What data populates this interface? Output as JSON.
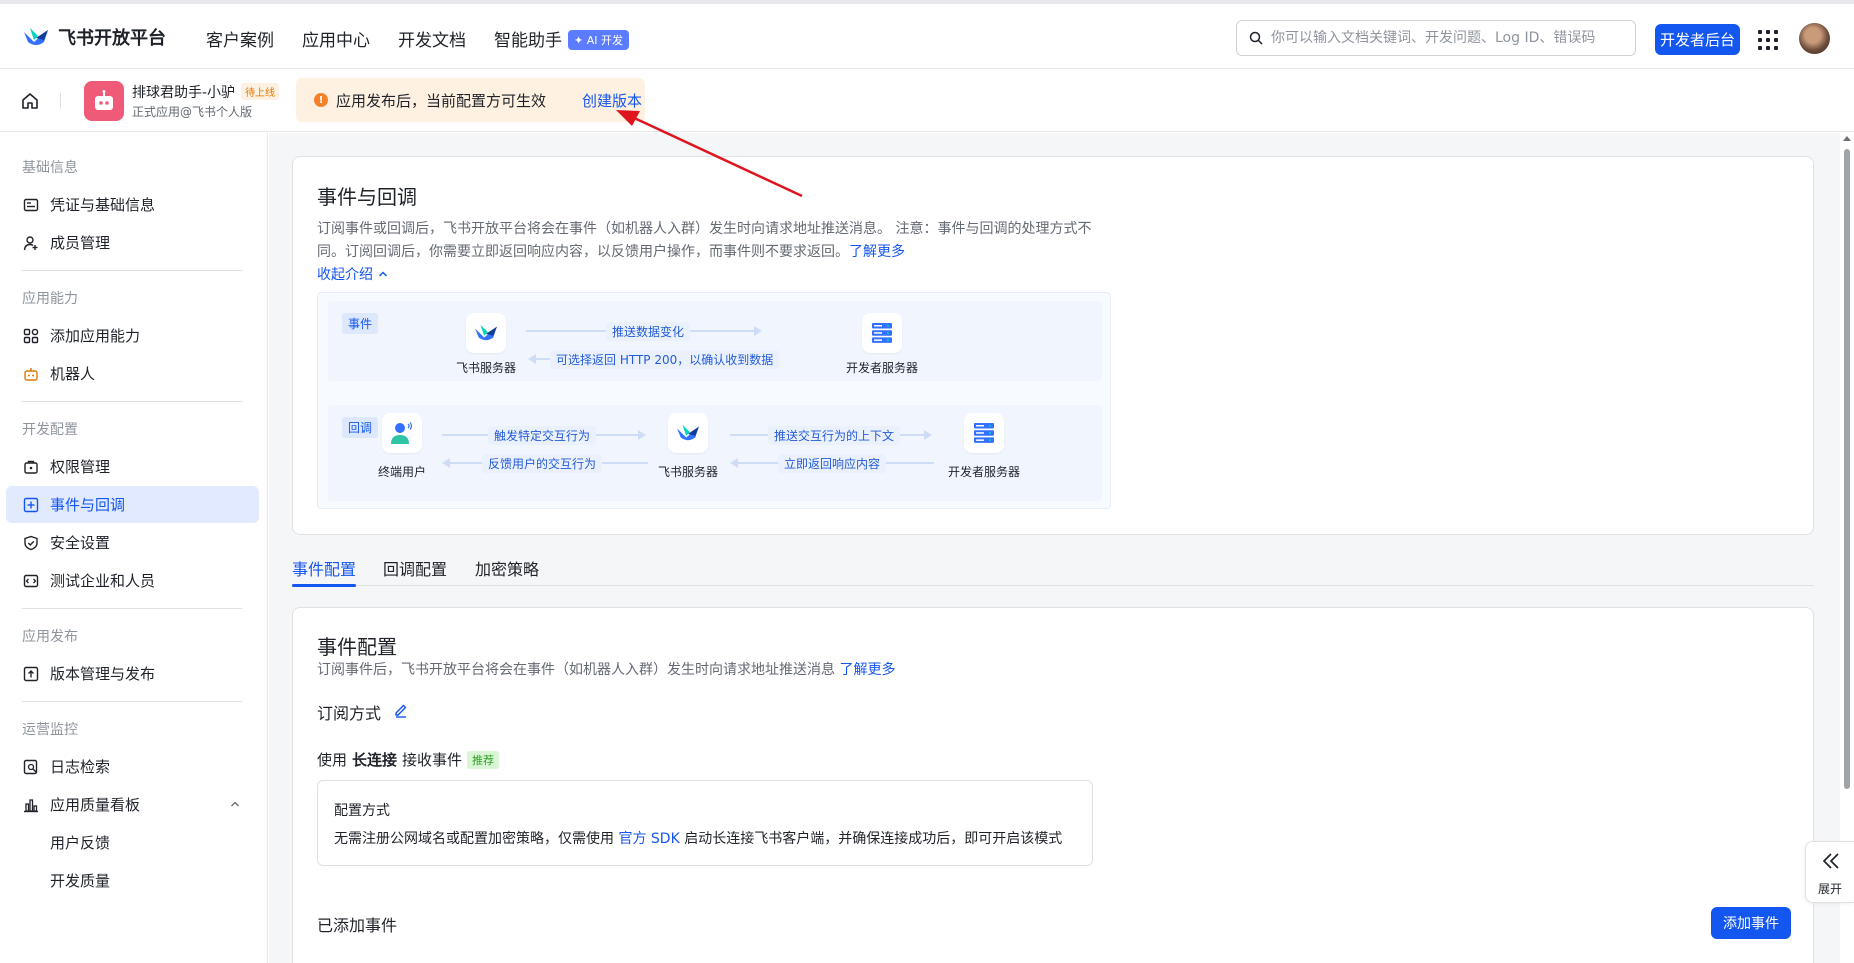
{
  "topbar": {
    "logo_text": "飞书开放平台",
    "nav": [
      "客户案例",
      "应用中心",
      "开发文档",
      "智能助手"
    ],
    "ai_badge": "✦ AI 开发",
    "search_placeholder": "你可以输入文档关键词、开发问题、Log ID、错误码",
    "dev_console": "开发者后台"
  },
  "appbar": {
    "app_name": "排球君助手-小驴",
    "app_status": "待上线",
    "app_sub": "正式应用@飞书个人版",
    "notice_text": "应用发布后，当前配置方可生效",
    "notice_link": "创建版本"
  },
  "sidebar": {
    "groups": [
      "基础信息",
      "应用能力",
      "开发配置",
      "应用发布",
      "运营监控"
    ],
    "items": [
      {
        "label": "凭证与基础信息",
        "icon": "credential-icon"
      },
      {
        "label": "成员管理",
        "icon": "member-add-icon"
      },
      {
        "label": "添加应用能力",
        "icon": "app-grid-icon"
      },
      {
        "label": "机器人",
        "icon": "robot-icon"
      },
      {
        "label": "权限管理",
        "icon": "permission-icon"
      },
      {
        "label": "事件与回调",
        "icon": "event-icon"
      },
      {
        "label": "安全设置",
        "icon": "shield-icon"
      },
      {
        "label": "测试企业和人员",
        "icon": "test-icon"
      },
      {
        "label": "版本管理与发布",
        "icon": "upload-icon"
      },
      {
        "label": "日志检索",
        "icon": "log-search-icon"
      },
      {
        "label": "应用质量看板",
        "icon": "chart-icon"
      },
      {
        "label": "用户反馈",
        "icon": ""
      },
      {
        "label": "开发质量",
        "icon": ""
      }
    ]
  },
  "intro": {
    "title": "事件与回调",
    "desc_line1": "订阅事件或回调后，飞书开放平台将会在事件（如机器人入群）发生时向请求地址推送消息。 注意：事件与回调的处理方式不",
    "desc_line2": "同。订阅回调后，你需要立即返回响应内容，以反馈用户操作，而事件则不要求返回。",
    "learn_more": "了解更多",
    "collapse": "收起介绍"
  },
  "flow": {
    "event_tag": "事件",
    "callback_tag": "回调",
    "feishu_server": "飞书服务器",
    "dev_server": "开发者服务器",
    "end_user": "终端用户",
    "push_change": "推送数据变化",
    "return_200": "可选择返回 HTTP 200，以确认收到数据",
    "trigger": "触发特定交互行为",
    "feedback": "反馈用户的交互行为",
    "push_context": "推送交互行为的上下文",
    "return_now": "立即返回响应内容"
  },
  "tabs": [
    "事件配置",
    "回调配置",
    "加密策略"
  ],
  "event_config": {
    "title": "事件配置",
    "desc": "订阅事件后，飞书开放平台将会在事件（如机器人入群）发生时向请求地址推送消息",
    "learn_more": "了解更多",
    "sub_mode": "订阅方式",
    "mode_prefix": "使用",
    "mode_bold": "长连接",
    "mode_suffix": "接收事件",
    "recommend": "推荐",
    "cfg_title": "配置方式",
    "cfg_desc_a": "无需注册公网域名或配置加密策略，仅需使用",
    "cfg_sdk": "官方 SDK",
    "cfg_desc_b": "启动长连接飞书客户端，并确保连接成功后，即可开启该模式",
    "added": "已添加事件",
    "add_btn": "添加事件"
  },
  "expand_label": "展开",
  "colors": {
    "primary": "#1456f0",
    "annotation_arrow": "#e0141e"
  }
}
